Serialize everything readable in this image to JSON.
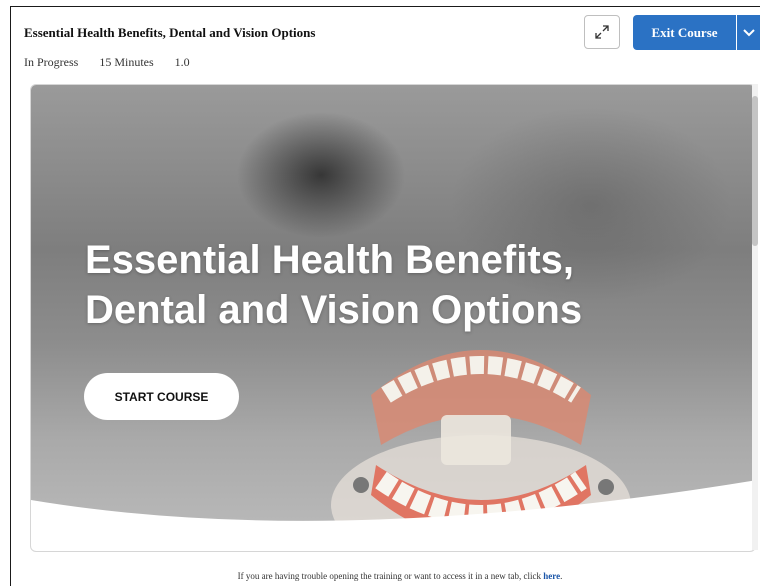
{
  "header": {
    "title": "Essential Health Benefits, Dental and Vision Options",
    "status": "In Progress",
    "duration": "15 Minutes",
    "version": "1.0",
    "expand_icon": "expand-arrows-icon",
    "exit_label": "Exit Course",
    "exit_dropdown_icon": "chevron-down-icon"
  },
  "hero": {
    "title_line1": "Essential Health Benefits,",
    "title_line2": "Dental and Vision Options",
    "start_label": "START COURSE"
  },
  "footer": {
    "note": "If you are having trouble opening the training or want to access it in a new tab, click ",
    "link_label": "here",
    "link_suffix": "."
  },
  "colors": {
    "accent": "#2b72c4",
    "link": "#1a55a8"
  }
}
